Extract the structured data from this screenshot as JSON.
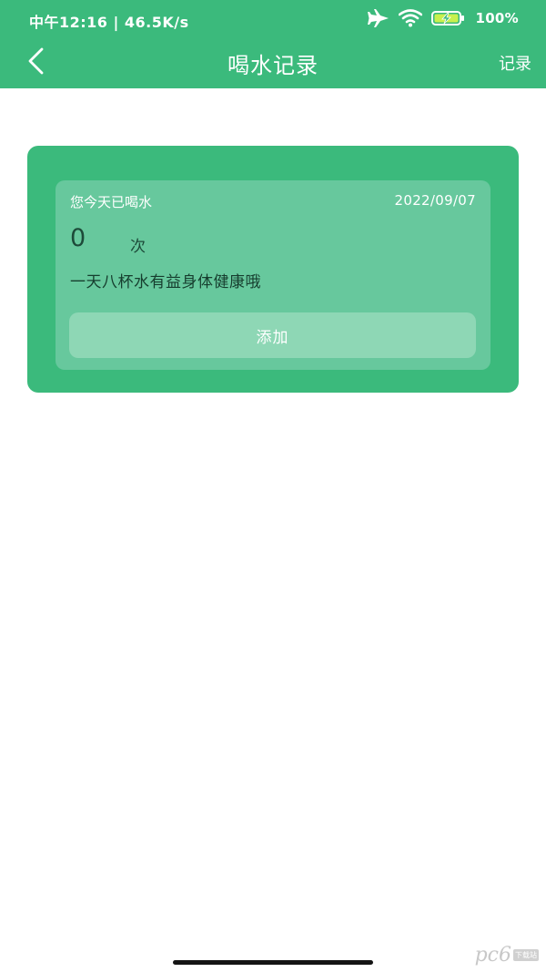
{
  "status_bar": {
    "time_speed": "中午12:16 | 46.5K/s",
    "airplane_icon": "airplane-icon",
    "wifi_icon": "wifi-icon",
    "battery_icon": "battery-charging-icon",
    "battery_level": "100%"
  },
  "nav": {
    "back_icon": "chevron-left-icon",
    "title": "喝水记录",
    "action": "记录"
  },
  "card": {
    "label": "您今天已喝水",
    "date": "2022/09/07",
    "count": "0",
    "unit": "次",
    "tip": "一天八杯水有益身体健康哦",
    "add_button": "添加"
  },
  "watermark": {
    "logo": "pc6",
    "tag": "下载站"
  },
  "colors": {
    "brand_green": "#3bba7c",
    "inner_card": "#67c89d",
    "add_button_bg": "#8ed7b5",
    "count_text": "#1d4a39"
  }
}
